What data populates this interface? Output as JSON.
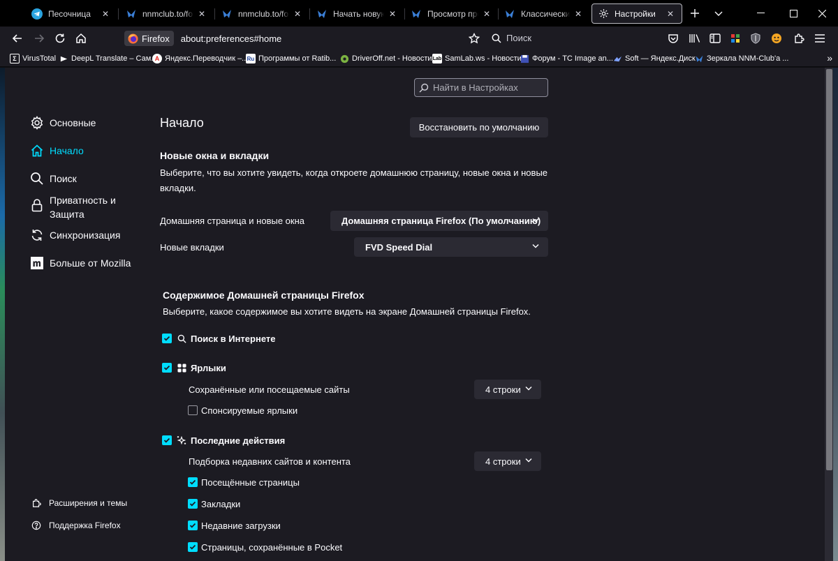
{
  "tabs": [
    {
      "title": "Песочница",
      "icon": "telegram-icon"
    },
    {
      "title": "nnmclub.to/forum",
      "icon": "butterfly-icon"
    },
    {
      "title": "nnmclub.to/forum",
      "icon": "butterfly-icon"
    },
    {
      "title": "Начать новую тему",
      "icon": "butterfly-icon"
    },
    {
      "title": "Просмотр профиля",
      "icon": "butterfly-icon"
    },
    {
      "title": "Классический форум",
      "icon": "butterfly-icon"
    },
    {
      "title": "Настройки",
      "icon": "gear-icon",
      "active": true
    }
  ],
  "navbar": {
    "identity_label": "Firefox",
    "url": "about:preferences#home",
    "search_label": "Поиск"
  },
  "bookmarks": [
    {
      "label": "VirusTotal"
    },
    {
      "label": "DeepL Translate – Сам..."
    },
    {
      "label": "Яндекс.Переводчик –..."
    },
    {
      "label": "Программы от Ratib..."
    },
    {
      "label": "DriverOff.net - Новости"
    },
    {
      "label": "SamLab.ws - Новости"
    },
    {
      "label": "Форум - TC Image an..."
    },
    {
      "label": "Soft — Яндекс.Диск"
    },
    {
      "label": "Зеркала NNM-Club'a ..."
    }
  ],
  "settings": {
    "search_placeholder": "Найти в Настройках",
    "categories": [
      {
        "label": "Основные",
        "icon": "gear-icon"
      },
      {
        "label": "Начало",
        "icon": "home-icon",
        "selected": true
      },
      {
        "label": "Поиск",
        "icon": "search-icon"
      },
      {
        "label": "Приватность и Защита",
        "icon": "lock-icon"
      },
      {
        "label": "Синхронизация",
        "icon": "sync-icon"
      },
      {
        "label": "Больше от Mozilla",
        "icon": "mozilla-icon"
      }
    ],
    "footer_links": [
      {
        "label": "Расширения и темы",
        "icon": "puzzle-icon"
      },
      {
        "label": "Поддержка Firefox",
        "icon": "help-icon"
      }
    ],
    "page_title": "Начало",
    "restore_defaults": "Восстановить по умолчанию",
    "new_windows": {
      "heading": "Новые окна и вкладки",
      "description": "Выберите, что вы хотите увидеть, когда откроете домашнюю страницу, новые окна и новые вкладки.",
      "homepage_label": "Домашняя страница и новые окна",
      "homepage_value": "Домашняя страница Firefox (По умолчанию)",
      "newtabs_label": "Новые вкладки",
      "newtabs_value": "FVD Speed Dial"
    },
    "home_content": {
      "heading": "Содержимое Домашней страницы Firefox",
      "description": "Выберите, какое содержимое вы хотите видеть на экране Домашней страницы Firefox.",
      "web_search": {
        "label": "Поиск в Интернете",
        "checked": true
      },
      "shortcuts": {
        "label": "Ярлыки",
        "checked": true,
        "rows_label": "Сохранённые или посещаемые сайты",
        "rows_value": "4 строки",
        "sponsored": {
          "label": "Спонсируемые ярлыки",
          "checked": false
        }
      },
      "recent": {
        "label": "Последние действия",
        "checked": true,
        "rows_label": "Подборка недавних сайтов и контента",
        "rows_value": "4 строки",
        "items": [
          {
            "label": "Посещённые страницы",
            "checked": true
          },
          {
            "label": "Закладки",
            "checked": true
          },
          {
            "label": "Недавние загрузки",
            "checked": true
          },
          {
            "label": "Страницы, сохранённые в Pocket",
            "checked": true
          }
        ]
      }
    }
  },
  "colors": {
    "accent": "#00ddff",
    "background": "#1c1b22",
    "control": "#2b2a33"
  }
}
